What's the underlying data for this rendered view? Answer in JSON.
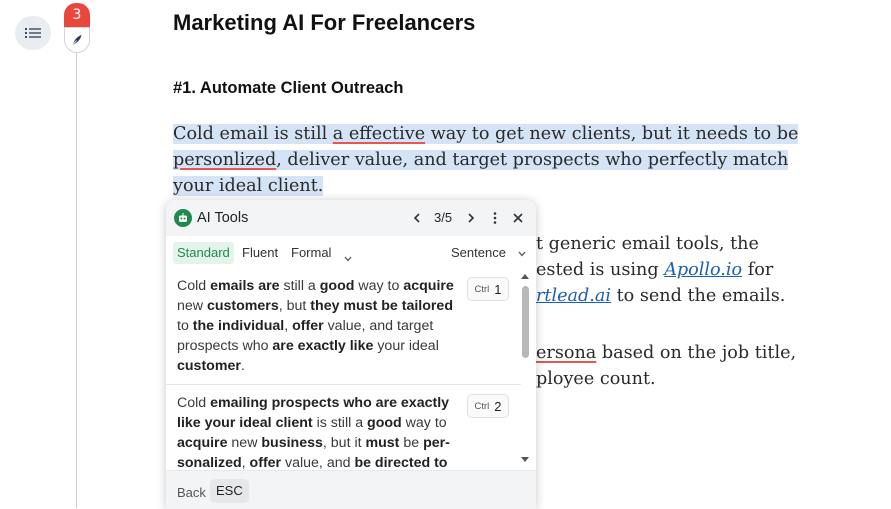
{
  "gutter": {
    "badge_count": "3"
  },
  "doc": {
    "title": "Marketing AI For Freelancers",
    "heading": "#1. Automate Client Outreach",
    "p1": {
      "line1_a": "Cold email is still ",
      "line1_err": "a effective",
      "line1_b": " way to get new clients, but it needs to be",
      "line2_err": "personlized",
      "line2_b": ", deliver value, and target prospects who perfectly match",
      "line3": "your ideal client."
    },
    "p2": {
      "line1": "t generic email tools, the",
      "line2_a": "ested is using ",
      "line2_link": "Apollo.io",
      "line2_b": " for",
      "line3_link": "rtlead.ai",
      "line3_b": " to send the emails."
    },
    "p3": {
      "line1_err": "ersona",
      "line1_b": " based on the job title,",
      "line2": "ployee count."
    }
  },
  "panel": {
    "title": "AI Tools",
    "pager": "3/5",
    "modes": [
      "Standard",
      "Fluent",
      "Formal"
    ],
    "scope": "Sentence",
    "suggestions": [
      {
        "html": "Cold <b>emails are</b> still a <b>good</b> way to <b>acquire</b> new <b>customers</b>, but <b>they must be tailored</b> to <b>the individual</b>, <b>offer</b> value, and target prospects who <b>are exactly like</b> your ideal <b>customer</b>.",
        "ctrl": "Ctrl",
        "num": "1"
      },
      {
        "html": "Cold <b>emailing prospects who are exactly like your ideal client</b> is still a <b>good</b> way to <b>acquire</b> new <b>business</b>, but it <b>must</b> be <b>per-sonalized</b>, <b>offer</b> value, and <b>be directed to</b>",
        "ctrl": "Ctrl",
        "num": "2"
      }
    ],
    "back": "Back",
    "esc": "ESC"
  }
}
